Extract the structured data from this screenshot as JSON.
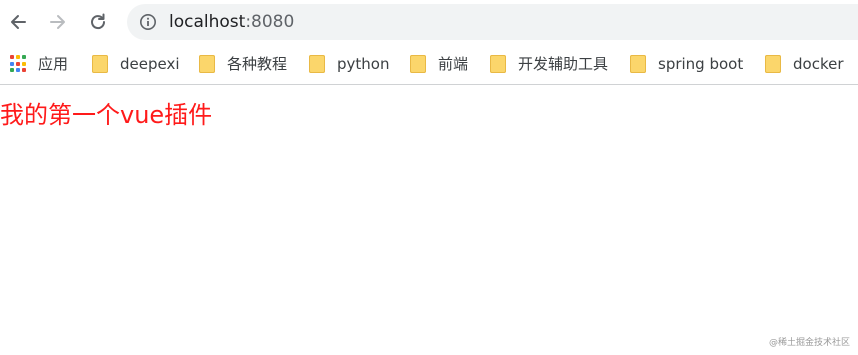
{
  "toolbar": {
    "url_host": "localhost",
    "url_port": ":8080"
  },
  "bookmarks": [
    {
      "label": "应用",
      "icon": "apps-grid-icon"
    },
    {
      "label": "deepexi",
      "icon": "folder-icon"
    },
    {
      "label": "各种教程",
      "icon": "folder-icon"
    },
    {
      "label": "python",
      "icon": "folder-icon"
    },
    {
      "label": "前端",
      "icon": "folder-icon"
    },
    {
      "label": "开发辅助工具",
      "icon": "folder-icon"
    },
    {
      "label": "spring boot",
      "icon": "folder-icon"
    },
    {
      "label": "docker",
      "icon": "folder-icon"
    }
  ],
  "page": {
    "heading": "我的第一个vue插件",
    "heading_color": "#ff1a1a"
  },
  "watermark": "@稀土掘金技术社区",
  "colors": {
    "folder": "#fbd66b",
    "omnibox_bg": "#f1f3f4"
  }
}
